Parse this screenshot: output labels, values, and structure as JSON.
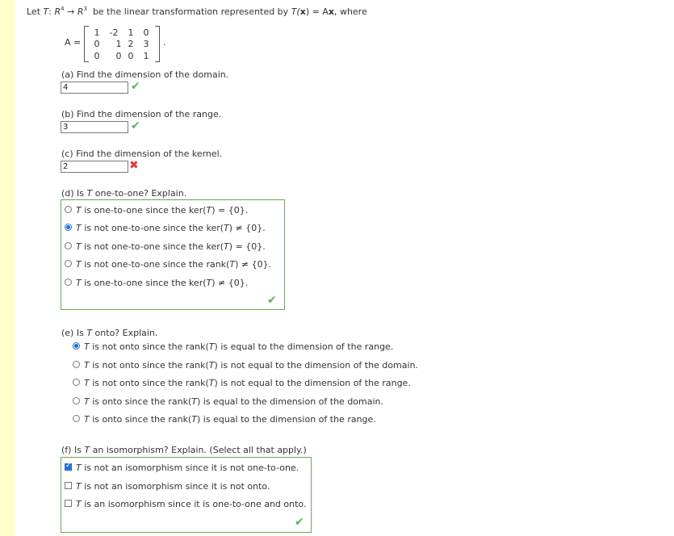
{
  "problem": {
    "intro_let": "Let",
    "T": "T",
    "colon": ":",
    "R4": "R",
    "sup4": "4",
    "arrow": "→",
    "R3": "R",
    "sup3": "3",
    "intro_rest": "be the linear transformation represented by",
    "Tx": "T(",
    "x": "x",
    "eqAx": ") = A",
    "x2": "x",
    "where": ", where",
    "A_label": "A =",
    "period": ".",
    "matrix": [
      [
        "1",
        "-2",
        "1",
        "0"
      ],
      [
        "0",
        "1",
        "2",
        "3"
      ],
      [
        "0",
        "0",
        "0",
        "1"
      ]
    ]
  },
  "part_a": {
    "question": "(a) Find the dimension of the domain.",
    "answer": "4",
    "status": "correct"
  },
  "part_b": {
    "question": "(b) Find the dimension of the range.",
    "answer": "3",
    "status": "correct"
  },
  "part_c": {
    "question": "(c) Find the dimension of the kernel.",
    "answer": "2",
    "status": "incorrect"
  },
  "part_d": {
    "q_prefix": "(d) Is ",
    "q_T": "T",
    "q_suffix": " one-to-one? Explain.",
    "options": [
      {
        "T": "T",
        "rest": " is one-to-one since the ker(",
        "T2": "T",
        "end": ") = {0}.",
        "selected": false
      },
      {
        "T": "T",
        "rest": " is not one-to-one since the ker(",
        "T2": "T",
        "end": ") ≠ {0}.",
        "selected": true
      },
      {
        "T": "T",
        "rest": " is not one-to-one since the ker(",
        "T2": "T",
        "end": ") = {0}.",
        "selected": false
      },
      {
        "T": "T",
        "rest": " is not one-to-one since the rank(",
        "T2": "T",
        "end": ") ≠ {0}.",
        "selected": false
      },
      {
        "T": "T",
        "rest": " is one-to-one since the ker(",
        "T2": "T",
        "end": ") ≠ {0}.",
        "selected": false
      }
    ],
    "status": "correct"
  },
  "part_e": {
    "q_prefix": "(e) Is ",
    "q_T": "T",
    "q_suffix": " onto? Explain.",
    "options": [
      {
        "T": "T",
        "rest": " is not onto since the rank(",
        "T2": "T",
        "end": ") is equal to the dimension of the range.",
        "selected": true
      },
      {
        "T": "T",
        "rest": " is not onto since the rank(",
        "T2": "T",
        "end": ") is not equal to the dimension of the domain.",
        "selected": false
      },
      {
        "T": "T",
        "rest": " is not onto since the rank(",
        "T2": "T",
        "end": ") is not equal to the dimension of the range.",
        "selected": false
      },
      {
        "T": "T",
        "rest": " is onto since the rank(",
        "T2": "T",
        "end": ") is equal to the dimension of the domain.",
        "selected": false
      },
      {
        "T": "T",
        "rest": " is onto since the rank(",
        "T2": "T",
        "end": ") is equal to the dimension of the range.",
        "selected": false
      }
    ]
  },
  "part_f": {
    "q_prefix": "(f) Is ",
    "q_T": "T",
    "q_suffix": " an isomorphism? Explain. (Select all that apply.)",
    "options": [
      {
        "T": "T",
        "rest": " is not an isomorphism since it is not one-to-one.",
        "selected": true
      },
      {
        "T": "T",
        "rest": " is not an isomorphism since it is not onto.",
        "selected": false
      },
      {
        "T": "T",
        "rest": " is an isomorphism since it is one-to-one and onto.",
        "selected": false
      }
    ],
    "status": "correct"
  },
  "colors": {
    "correct": "#5bb25b",
    "incorrect": "#e03b3b",
    "box_border": "#6aa84f",
    "radio_selected": "#1e6bd6",
    "stripe": "#ffffcc"
  },
  "icons": {
    "correct": "check-icon",
    "incorrect": "x-icon"
  }
}
